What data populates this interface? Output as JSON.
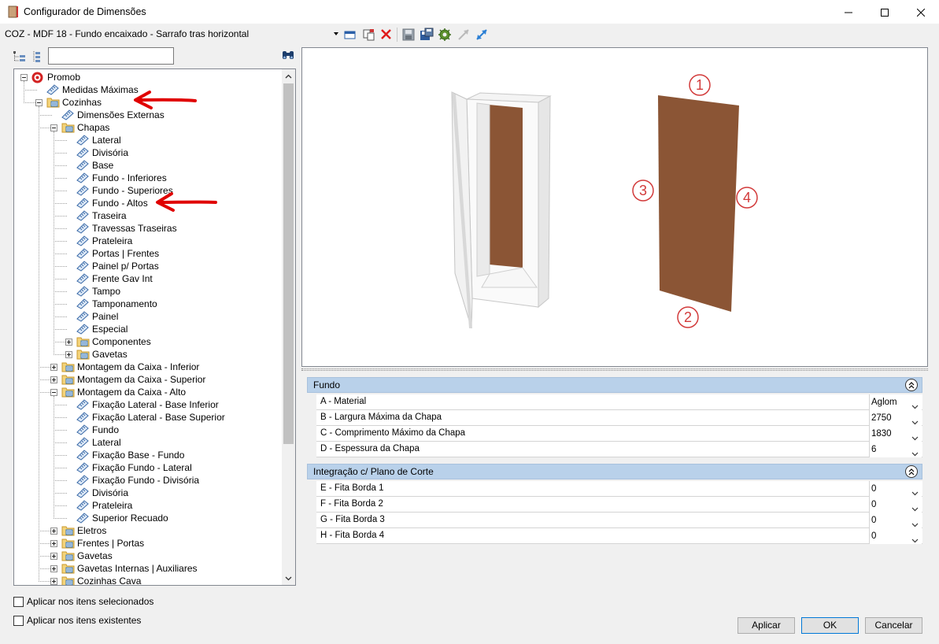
{
  "window": {
    "title": "Configurador de Dimensões",
    "minimize_icon": "minimize-icon",
    "maximize_icon": "maximize-icon",
    "close_icon": "close-icon"
  },
  "toolbar": {
    "profile_selected": "COZ - MDF 18 - Fundo encaixado - Sarrafo tras horizontal",
    "icons": [
      "profile-window-icon",
      "copy-profile-icon",
      "delete-icon",
      "save-icon",
      "save-as-icon",
      "settings-gear-icon",
      "collapse-arrows-icon",
      "expand-arrows-icon"
    ]
  },
  "left_tools": {
    "search_placeholder": "",
    "search_value": "",
    "icons": [
      "tree-expand-icon",
      "tree-list-icon",
      "binoculars-search-icon"
    ]
  },
  "tree": {
    "items": [
      {
        "label": "Promob",
        "level": 0,
        "expander": "minus",
        "icon": "promob-logo-icon"
      },
      {
        "label": "Medidas Máximas",
        "level": 1,
        "expander": "",
        "icon": "ruler-icon"
      },
      {
        "label": "Cozinhas",
        "level": 1,
        "expander": "minus",
        "icon": "folder-icon"
      },
      {
        "label": "Dimensões Externas",
        "level": 2,
        "expander": "",
        "icon": "ruler-icon"
      },
      {
        "label": "Chapas",
        "level": 2,
        "expander": "minus",
        "icon": "folder-icon"
      },
      {
        "label": "Lateral",
        "level": 3,
        "expander": "",
        "icon": "ruler-icon"
      },
      {
        "label": "Divisória",
        "level": 3,
        "expander": "",
        "icon": "ruler-icon"
      },
      {
        "label": "Base",
        "level": 3,
        "expander": "",
        "icon": "ruler-icon"
      },
      {
        "label": "Fundo - Inferiores",
        "level": 3,
        "expander": "",
        "icon": "ruler-icon"
      },
      {
        "label": "Fundo - Superiores",
        "level": 3,
        "expander": "",
        "icon": "ruler-icon"
      },
      {
        "label": "Fundo - Altos",
        "level": 3,
        "expander": "",
        "icon": "ruler-icon"
      },
      {
        "label": "Traseira",
        "level": 3,
        "expander": "",
        "icon": "ruler-icon"
      },
      {
        "label": "Travessas Traseiras",
        "level": 3,
        "expander": "",
        "icon": "ruler-icon"
      },
      {
        "label": "Prateleira",
        "level": 3,
        "expander": "",
        "icon": "ruler-icon"
      },
      {
        "label": "Portas | Frentes",
        "level": 3,
        "expander": "",
        "icon": "ruler-icon"
      },
      {
        "label": "Painel p/ Portas",
        "level": 3,
        "expander": "",
        "icon": "ruler-icon"
      },
      {
        "label": "Frente Gav Int",
        "level": 3,
        "expander": "",
        "icon": "ruler-icon"
      },
      {
        "label": "Tampo",
        "level": 3,
        "expander": "",
        "icon": "ruler-icon"
      },
      {
        "label": "Tamponamento",
        "level": 3,
        "expander": "",
        "icon": "ruler-icon"
      },
      {
        "label": "Painel",
        "level": 3,
        "expander": "",
        "icon": "ruler-icon"
      },
      {
        "label": "Especial",
        "level": 3,
        "expander": "",
        "icon": "ruler-icon"
      },
      {
        "label": "Componentes",
        "level": 3,
        "expander": "plus",
        "icon": "folder-icon"
      },
      {
        "label": "Gavetas",
        "level": 3,
        "expander": "plus",
        "icon": "folder-icon"
      },
      {
        "label": "Montagem da Caixa - Inferior",
        "level": 2,
        "expander": "plus",
        "icon": "folder-icon"
      },
      {
        "label": "Montagem da Caixa - Superior",
        "level": 2,
        "expander": "plus",
        "icon": "folder-icon"
      },
      {
        "label": "Montagem da Caixa - Alto",
        "level": 2,
        "expander": "minus",
        "icon": "folder-icon"
      },
      {
        "label": "Fixação Lateral - Base Inferior",
        "level": 3,
        "expander": "",
        "icon": "ruler-icon"
      },
      {
        "label": "Fixação Lateral - Base Superior",
        "level": 3,
        "expander": "",
        "icon": "ruler-icon"
      },
      {
        "label": "Fundo",
        "level": 3,
        "expander": "",
        "icon": "ruler-icon"
      },
      {
        "label": "Lateral",
        "level": 3,
        "expander": "",
        "icon": "ruler-icon"
      },
      {
        "label": "Fixação Base - Fundo",
        "level": 3,
        "expander": "",
        "icon": "ruler-icon"
      },
      {
        "label": "Fixação Fundo - Lateral",
        "level": 3,
        "expander": "",
        "icon": "ruler-icon"
      },
      {
        "label": "Fixação Fundo - Divisória",
        "level": 3,
        "expander": "",
        "icon": "ruler-icon"
      },
      {
        "label": "Divisória",
        "level": 3,
        "expander": "",
        "icon": "ruler-icon"
      },
      {
        "label": "Prateleira",
        "level": 3,
        "expander": "",
        "icon": "ruler-icon"
      },
      {
        "label": "Superior Recuado",
        "level": 3,
        "expander": "",
        "icon": "ruler-icon"
      },
      {
        "label": "Eletros",
        "level": 2,
        "expander": "plus",
        "icon": "folder-icon"
      },
      {
        "label": "Frentes | Portas",
        "level": 2,
        "expander": "plus",
        "icon": "folder-icon"
      },
      {
        "label": "Gavetas",
        "level": 2,
        "expander": "plus",
        "icon": "folder-icon"
      },
      {
        "label": "Gavetas Internas | Auxiliares",
        "level": 2,
        "expander": "plus",
        "icon": "folder-icon"
      },
      {
        "label": "Cozinhas Cava",
        "level": 2,
        "expander": "plus",
        "icon": "folder-icon"
      }
    ]
  },
  "checkboxes": [
    {
      "label": "Aplicar nos itens selecionados",
      "checked": false
    },
    {
      "label": "Aplicar nos itens existentes",
      "checked": false
    }
  ],
  "preview": {
    "markers": [
      "1",
      "2",
      "3",
      "4"
    ],
    "panel_color": "#8b5535",
    "marker_color": "#d23a3a"
  },
  "properties": {
    "groups": [
      {
        "title": "Fundo",
        "rows": [
          {
            "name": "A - Material",
            "value": "Aglom"
          },
          {
            "name": "B - Largura Máxima da Chapa",
            "value": "2750"
          },
          {
            "name": "C - Comprimento Máximo da Chapa",
            "value": "1830"
          },
          {
            "name": "D - Espessura da Chapa",
            "value": "6"
          }
        ]
      },
      {
        "title": "Integração c/ Plano de Corte",
        "rows": [
          {
            "name": "E - Fita Borda 1",
            "value": "0"
          },
          {
            "name": "F - Fita Borda 2",
            "value": "0"
          },
          {
            "name": "G - Fita Borda 3",
            "value": "0"
          },
          {
            "name": "H - Fita Borda 4",
            "value": "0"
          }
        ]
      }
    ]
  },
  "buttons": {
    "apply": "Aplicar",
    "ok": "OK",
    "cancel": "Cancelar"
  },
  "colors": {
    "group_header": "#b9d1ea",
    "annotation_arrow": "#e00000"
  }
}
